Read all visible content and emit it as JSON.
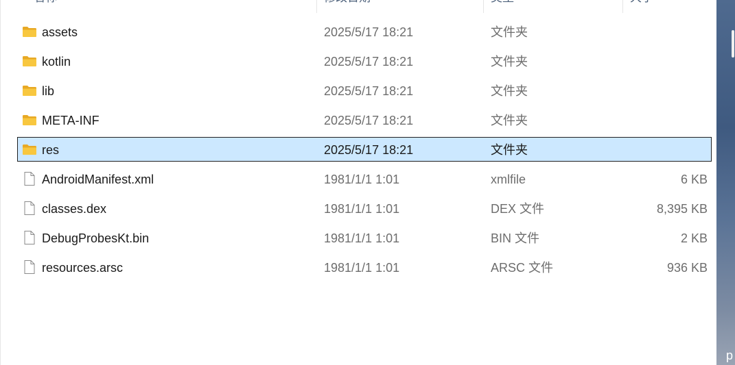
{
  "header": {
    "name": "名称",
    "date_modified": "修改日期",
    "type": "类型",
    "size": "大小"
  },
  "files": [
    {
      "name": "assets",
      "date": "2025/5/17 18:21",
      "type": "文件夹",
      "size": "",
      "icon": "folder-icon",
      "selected": false
    },
    {
      "name": "kotlin",
      "date": "2025/5/17 18:21",
      "type": "文件夹",
      "size": "",
      "icon": "folder-icon",
      "selected": false
    },
    {
      "name": "lib",
      "date": "2025/5/17 18:21",
      "type": "文件夹",
      "size": "",
      "icon": "folder-icon",
      "selected": false
    },
    {
      "name": "META-INF",
      "date": "2025/5/17 18:21",
      "type": "文件夹",
      "size": "",
      "icon": "folder-icon",
      "selected": false
    },
    {
      "name": "res",
      "date": "2025/5/17 18:21",
      "type": "文件夹",
      "size": "",
      "icon": "folder-icon",
      "selected": true
    },
    {
      "name": "AndroidManifest.xml",
      "date": "1981/1/1 1:01",
      "type": "xmlfile",
      "size": "6 KB",
      "icon": "file-icon",
      "selected": false
    },
    {
      "name": "classes.dex",
      "date": "1981/1/1 1:01",
      "type": "DEX 文件",
      "size": "8,395 KB",
      "icon": "file-icon",
      "selected": false
    },
    {
      "name": "DebugProbesKt.bin",
      "date": "1981/1/1 1:01",
      "type": "BIN 文件",
      "size": "2 KB",
      "icon": "file-icon",
      "selected": false
    },
    {
      "name": "resources.arsc",
      "date": "1981/1/1 1:01",
      "type": "ARSC 文件",
      "size": "936 KB",
      "icon": "file-icon",
      "selected": false
    }
  ],
  "background_peek_text": "p",
  "colors": {
    "selection_fill": "#cce8ff",
    "selection_border": "#1f1f1f",
    "folder_yellow": "#f8c73f",
    "secondary_text": "#6d6d6d",
    "header_text": "#4c607a"
  }
}
